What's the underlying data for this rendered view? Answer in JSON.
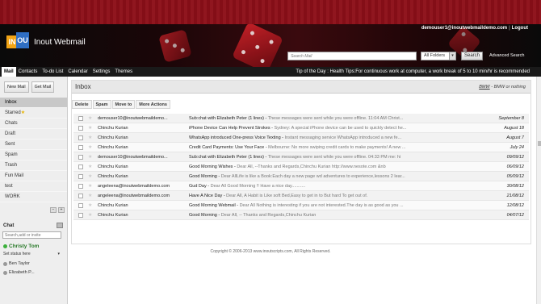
{
  "header": {
    "app_name": "Inout Webmail",
    "logo_left": "IN",
    "logo_right": "OU",
    "user_email": "demouser1@inoutwebmaildemo.com",
    "separator": "|",
    "logout_label": "Logout",
    "search_placeholder": "Search Mail",
    "folder_select_value": "All Folders",
    "search_button": "Search",
    "advanced_search": "Advanced Search"
  },
  "nav": {
    "items": [
      {
        "label": "Mail",
        "active": true
      },
      {
        "label": "Contacts"
      },
      {
        "label": "To-do List"
      },
      {
        "label": "Calendar"
      },
      {
        "label": "Settings"
      },
      {
        "label": "Themes"
      }
    ],
    "tip_label": "Tip of the Day : Health Tips:",
    "tip_text": "For continuous work at computer, a work break of 5 to 10 min/hr is recommended"
  },
  "sidebar": {
    "new_mail": "New Mail",
    "get_mail": "Get Mail",
    "folders": [
      {
        "label": "Inbox",
        "active": true
      },
      {
        "label": "Starred"
      },
      {
        "label": "Chats"
      },
      {
        "label": "Draft"
      },
      {
        "label": "Sent"
      },
      {
        "label": "Spam"
      },
      {
        "label": "Trash"
      },
      {
        "label": "Fun Mail"
      },
      {
        "label": "test"
      },
      {
        "label": "WORK"
      }
    ],
    "minus": "−",
    "plus": "+"
  },
  "chat": {
    "title": "Chat",
    "search_placeholder": "Search,add or invite",
    "me": "Christy Tom",
    "status": "Set status here",
    "contacts": [
      "Ben Taylor",
      "Elizabeth P..."
    ]
  },
  "main": {
    "title": "Inbox",
    "ad_link": "BMW",
    "ad_text": "- BMW or nothing",
    "toolbar": [
      "Delete",
      "Spam",
      "Move to",
      "More Actions"
    ],
    "messages": [
      {
        "from": "demouser10@inoutwebmaildemo...",
        "subject": "Sub:chat with Elizabeth Peter (1 lines)",
        "preview": "These messages were sent while you were offline.  11:04 AM Christ...",
        "date": "September 8"
      },
      {
        "from": "Chinchu Kurian",
        "subject": "iPhone Device Can Help Prevent Strokes",
        "preview": "Sydney: A special iPhone device can be used to quickly detect he...",
        "date": "August 18"
      },
      {
        "from": "Chinchu Kurian",
        "subject": "WhatsApp introduced One-press Voice Texting",
        "preview": "Instant messaging service WhatsApp introduced a new fe...",
        "date": "August 7"
      },
      {
        "from": "Chinchu Kurian",
        "subject": "Credit Card Payments: Use Your Face",
        "preview": "Melbourne: No more swiping credit cards to make payments! A new ...",
        "date": "July 24"
      },
      {
        "from": "demouser10@inoutwebmaildemo...",
        "subject": "Sub:chat with Elizabeth Peter (1 lines)",
        "preview": "These messages were sent while you were offline.  04:33 PM me: hi",
        "date": "09/09/12"
      },
      {
        "from": "Chinchu Kurian",
        "subject": "Good Morning Wishes",
        "preview": "Dear All,   --Thanks and Regards,Chinchu Kurian http://www.nesote.com &nb",
        "date": "06/09/12"
      },
      {
        "from": "Chinchu Kurian",
        "subject": "Good Morning",
        "preview": "Dear AllLife is like a Book:Each day a new page wd adventures to experience,lessons 2 lear...",
        "date": "05/09/12"
      },
      {
        "from": "angeleena@inoutwebmaildemo.com",
        "subject": "Gud Day",
        "preview": "Dear All Good Morning !! Have a nice day...........",
        "date": "30/08/12"
      },
      {
        "from": "angeleena@inoutwebmaildemo.com",
        "subject": "Have A Nice Day",
        "preview": "Dear All,   A Habit is Like soft Bed,Easy to get in to But hard To get out of.",
        "date": "21/08/12"
      },
      {
        "from": "Chinchu Kurian",
        "subject": "Good Morning Webmail",
        "preview": "Dear All Nothing is interesting if you are not interested.The day is as good as you ...",
        "date": "12/08/12"
      },
      {
        "from": "Chinchu Kurian",
        "subject": "Good Morning",
        "preview": "Dear All,   -- Thanks and Regards,Chinchu Kurian",
        "date": "04/07/12"
      }
    ]
  },
  "footer": "Copyright © 2006-2013 www.inoutscripts.com, All Rights Reserved."
}
